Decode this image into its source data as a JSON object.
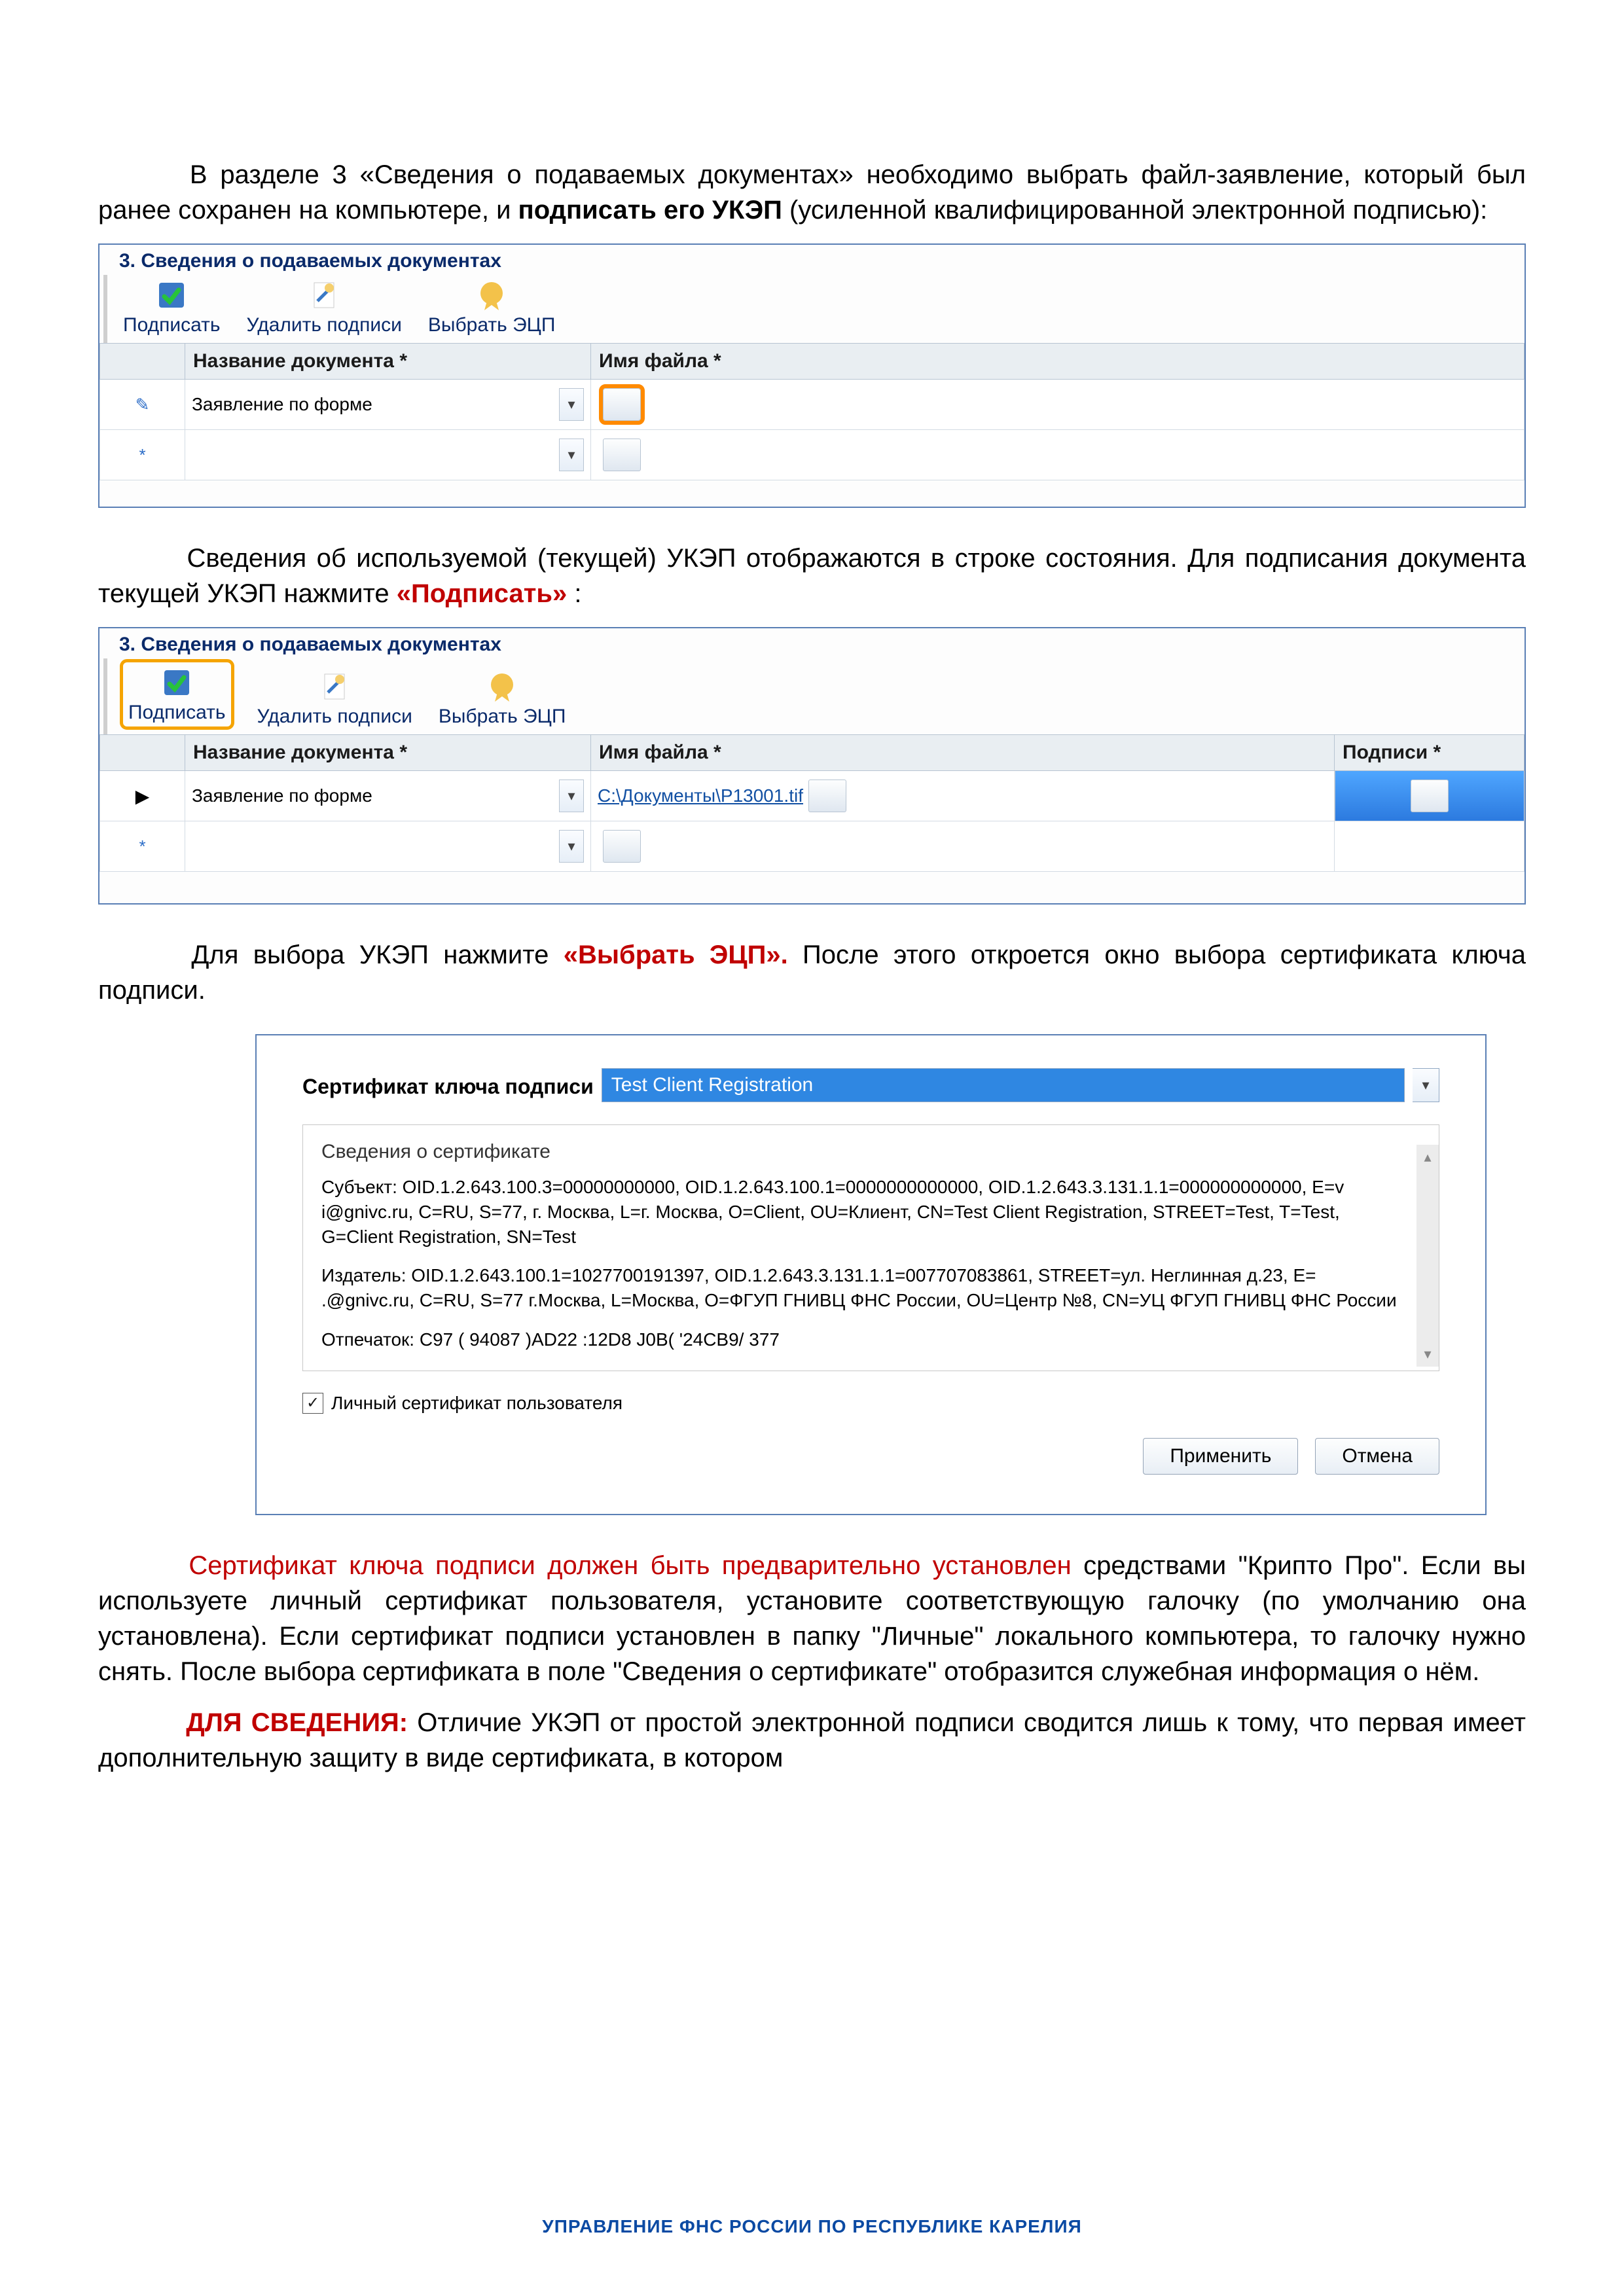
{
  "para1": "В разделе 3 «Сведения о подаваемых документах» необходимо выбрать файл-заявление, который был ранее сохранен на компьютере, и ",
  "para1_bold": "подписать его УКЭП ",
  "para1_tail": "(усиленной квалифицированной электронной подписью):",
  "panel_title": "3. Сведения о подаваемых документах",
  "toolbar": {
    "sign": "Подписать",
    "remove": "Удалить подписи",
    "choose": "Выбрать ЭЦП"
  },
  "table_headers": {
    "name": "Название документа *",
    "file": "Имя файла *",
    "sig": "Подписи *"
  },
  "rows": {
    "doc1_name": "Заявление по форме",
    "doc1_file_link": "С:\\Документы\\Р13001.tif"
  },
  "para2_a": "Сведения об используемой (текущей) УКЭП отображаются в строке состояния. Для подписания документа текущей УКЭП нажмите ",
  "para2_red": "«Подписать»",
  "para2_b": ":",
  "para3_a": "Для выбора УКЭП нажмите ",
  "para3_red": "«Выбрать ЭЦП».",
  "para3_b": " После этого откроется окно выбора сертификата ключа подписи.",
  "dialog": {
    "cert_label": "Сертификат ключа подписи",
    "cert_value": "Test Client Registration",
    "fieldset_legend": "Сведения о сертификате",
    "subject": "Субъект: OID.1.2.643.100.3=00000000000, OID.1.2.643.100.1=0000000000000, OID.1.2.643.3.131.1.1=000000000000, E=v   i@gnivc.ru, C=RU, S=77, г. Москва, L=г. Москва, O=Client, OU=Клиент, CN=Test Client Registration, STREET=Test, T=Test, G=Client Registration, SN=Test",
    "publisher": "Издатель: OID.1.2.643.100.1=1027700191397, OID.1.2.643.3.131.1.1=007707083861, STREET=ул. Неглинная д.23, E=       .@gnivc.ru, C=RU, S=77 г.Москва, L=Москва, O=ФГУП ГНИВЦ ФНС России, OU=Центр №8, CN=УЦ ФГУП ГНИВЦ ФНС России",
    "thumbprint": "Отпечаток: C97   (   94087   )AD22   :12D8   J0B(   '24CB9/   377",
    "personal_cert": "Личный сертификат пользователя",
    "apply": "Применить",
    "cancel": "Отмена"
  },
  "para4_red": "Сертификат ключа подписи должен быть предварительно установлен ",
  "para4_rest": "средствами \"Крипто Про\". Если вы используете личный сертификат пользователя, установите соответствующую галочку (по умолчанию она установлена). Если сертификат подписи установлен в папку \"Личные\" локального компьютера, то галочку нужно снять. После выбора сертификата в поле \"Сведения о сертификате\" отобразится служебная информация о нём.",
  "para5_lead": "ДЛЯ СВЕДЕНИЯ:",
  "para5_body": " Отличие УКЭП от простой электронной подписи сводится лишь к тому, что первая имеет дополнительную защиту в виде сертификата, в котором",
  "footer": "УПРАВЛЕНИЕ ФНС РОССИИ ПО РЕСПУБЛИКЕ КАРЕЛИЯ"
}
